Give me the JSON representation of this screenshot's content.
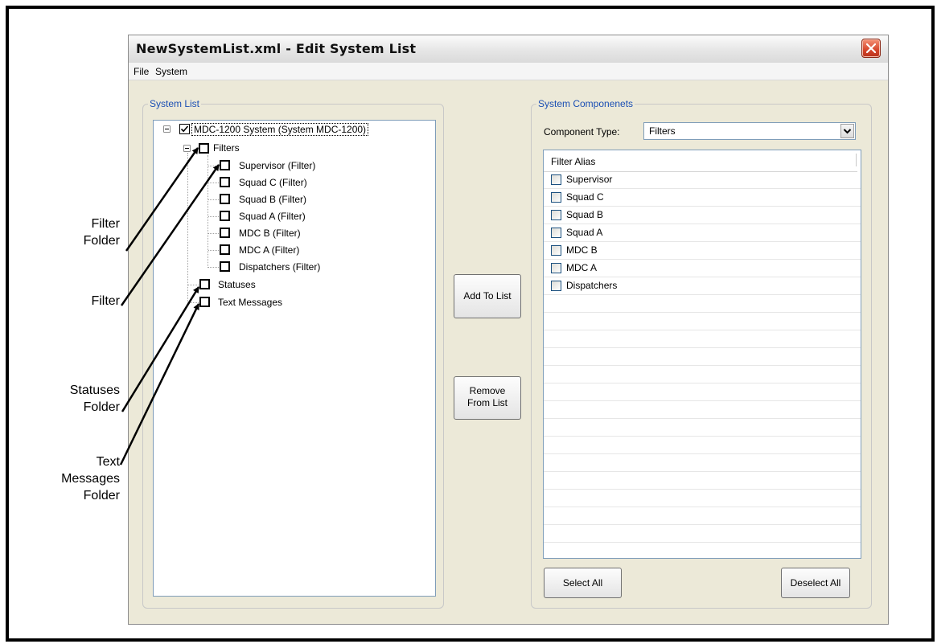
{
  "window": {
    "title": "NewSystemList.xml - Edit System List"
  },
  "menu": [
    "File",
    "System"
  ],
  "system_list": {
    "legend": "System List",
    "root": "MDC-1200 System  (System MDC-1200)",
    "filters_folder": "Filters",
    "filters": [
      "Supervisor  (Filter)",
      "Squad C  (Filter)",
      "Squad B  (Filter)",
      "Squad A  (Filter)",
      "MDC B  (Filter)",
      "MDC A  (Filter)",
      "Dispatchers  (Filter)"
    ],
    "statuses_folder": "Statuses",
    "text_messages_folder": "Text Messages"
  },
  "buttons": {
    "add": "Add To List",
    "remove_line1": "Remove",
    "remove_line2": "From List",
    "select_all": "Select All",
    "deselect_all": "Deselect All"
  },
  "components": {
    "legend": "System Componenets",
    "type_label": "Component Type:",
    "type_value": "Filters",
    "column_header": "Filter Alias",
    "items": [
      "Supervisor",
      "Squad C",
      "Squad B",
      "Squad A",
      "MDC B",
      "MDC A",
      "Dispatchers"
    ]
  },
  "callouts": {
    "filter_folder": [
      "Filter",
      "Folder"
    ],
    "filter": "Filter",
    "statuses_folder": [
      "Statuses",
      "Folder"
    ],
    "text_messages_folder": [
      "Text",
      "Messages",
      "Folder"
    ]
  },
  "colors": {
    "legend_blue": "#1b4fb4",
    "close_red": "#d5452b"
  }
}
